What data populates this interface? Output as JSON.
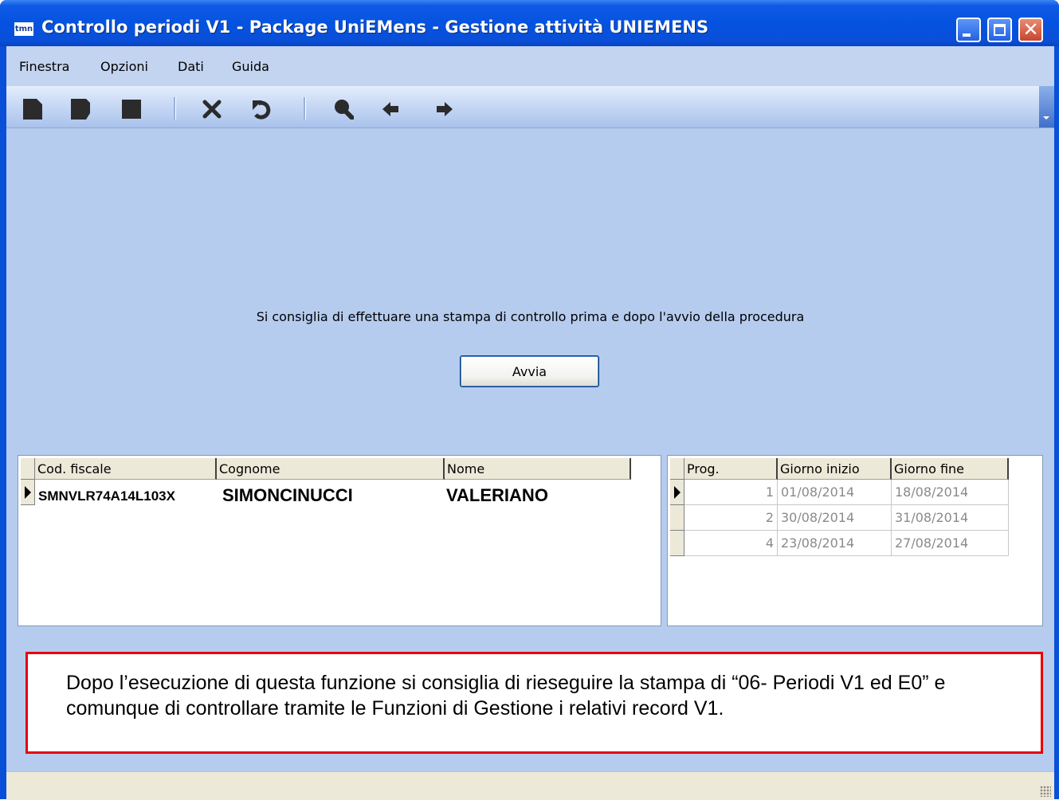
{
  "window": {
    "icon_text": "tmn",
    "title": "Controllo periodi V1 - Package UniEMens - Gestione attività UNIEMENS"
  },
  "menu": {
    "items": [
      "Finestra",
      "Opzioni",
      "Dati",
      "Guida"
    ]
  },
  "toolbar": {
    "icons": [
      "new-icon",
      "save-icon",
      "stop-icon",
      "delete-icon",
      "undo-icon",
      "search-icon",
      "previous-icon",
      "next-icon"
    ]
  },
  "main": {
    "advice_text": "Si consiglia di effettuare una stampa di controllo prima e dopo l'avvio della procedura",
    "start_button": "Avvia"
  },
  "persons_grid": {
    "columns": [
      "Cod. fiscale",
      "Cognome",
      "Nome"
    ],
    "rows": [
      {
        "cod_fiscale": "SMNVLR74A14L103X",
        "cognome": "SIMONCINUCCI",
        "nome": "VALERIANO"
      }
    ]
  },
  "periods_grid": {
    "columns": [
      "Prog.",
      "Giorno inizio",
      "Giorno fine"
    ],
    "rows": [
      {
        "prog": "1",
        "inizio": "01/08/2014",
        "fine": "18/08/2014"
      },
      {
        "prog": "2",
        "inizio": "30/08/2014",
        "fine": "31/08/2014"
      },
      {
        "prog": "4",
        "inizio": "23/08/2014",
        "fine": "27/08/2014"
      }
    ]
  },
  "note": {
    "text": "Dopo l’esecuzione di questa funzione si consiglia di rieseguire la stampa di “06- Periodi V1 ed E0” e comunque di controllare tramite le Funzioni di Gestione i relativi record V1."
  },
  "colors": {
    "titlebar": "#0a4fd8",
    "client_bg": "#b6ccef",
    "note_border": "#e60000"
  }
}
